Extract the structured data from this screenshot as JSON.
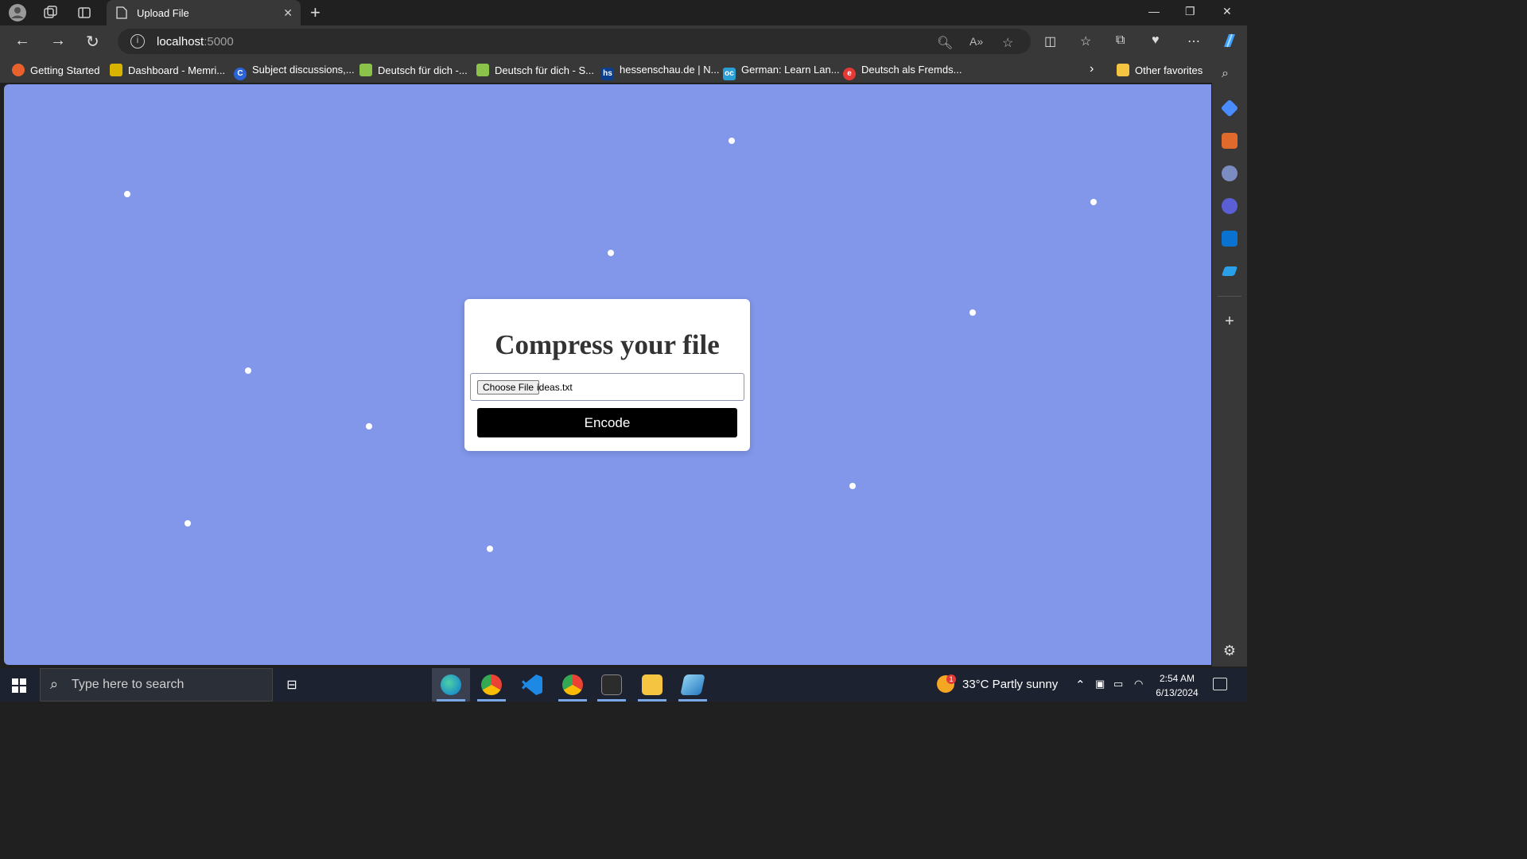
{
  "browser": {
    "tab_title": "Upload File",
    "url_host": "localhost",
    "url_port": ":5000"
  },
  "bookmarks": [
    {
      "label": "Getting Started",
      "color": "#e8602c"
    },
    {
      "label": "Dashboard - Memri...",
      "color": "#d8b400"
    },
    {
      "label": "Subject discussions,...",
      "color": "#2b63d9"
    },
    {
      "label": "Deutsch für dich -...",
      "color": "#8bc34a"
    },
    {
      "label": "Deutsch für dich - S...",
      "color": "#8bc34a"
    },
    {
      "label": "hessenschau.de | N...",
      "color": "#0d3f8f"
    },
    {
      "label": "German: Learn Lan...",
      "color": "#2a9fd6"
    },
    {
      "label": "Deutsch als Fremds...",
      "color": "#e53935"
    }
  ],
  "other_favorites": "Other favorites",
  "page": {
    "heading": "Compress your file",
    "choose_file_label": "Choose File",
    "file_name": "ideas.txt",
    "encode_label": "Encode",
    "background_color": "#8296ea"
  },
  "taskbar": {
    "search_placeholder": "Type here to search",
    "weather": "33°C  Partly sunny",
    "weather_badge": "1",
    "time": "2:54 AM",
    "date": "6/13/2024"
  }
}
